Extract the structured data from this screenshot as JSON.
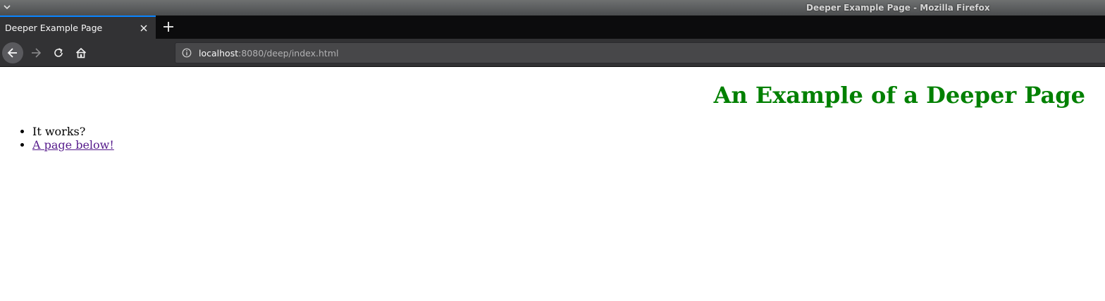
{
  "window": {
    "title": "Deeper Example Page - Mozilla Firefox"
  },
  "tabs": [
    {
      "label": "Deeper Example Page",
      "active": true
    }
  ],
  "toolbar": {
    "url_host": "localhost",
    "url_rest": ":8080/deep/index.html"
  },
  "icons": {
    "window_menu": "chevron-down-icon",
    "tab_close": "close-icon",
    "new_tab": "plus-icon",
    "back": "arrow-left-icon",
    "forward": "arrow-right-icon",
    "reload": "reload-icon",
    "home": "home-icon",
    "site_info": "info-icon"
  },
  "colors": {
    "heading": "#008000",
    "visited_link": "#551a8b",
    "active_tab_accent": "#0a84ff"
  },
  "page": {
    "heading": "An Example of a Deeper Page",
    "list": [
      {
        "text": "It works?"
      },
      {
        "text": "A page below!"
      }
    ]
  }
}
